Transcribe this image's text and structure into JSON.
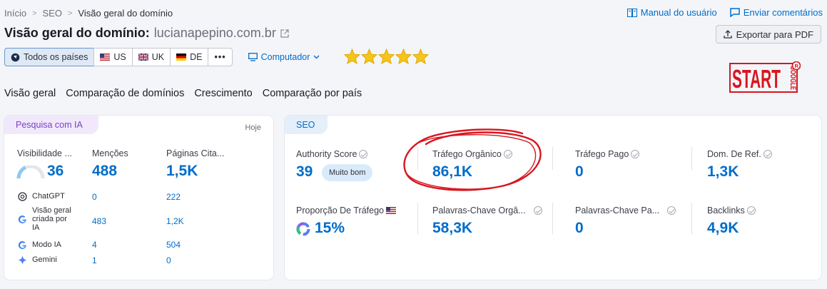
{
  "breadcrumb": {
    "home": "Início",
    "seo": "SEO",
    "current": "Visão geral do domínio"
  },
  "toplinks": {
    "manual": "Manual do usuário",
    "feedback": "Enviar comentários"
  },
  "title": {
    "label": "Visão geral do domínio:",
    "domain": "lucianapepino.com.br"
  },
  "export_label": "Exportar para PDF",
  "filters": {
    "all": "Todos os países",
    "us": "US",
    "uk": "UK",
    "de": "DE",
    "more": "•••",
    "device": "Computador"
  },
  "rating": {
    "stars": 5
  },
  "logo": {
    "text": "START",
    "sub": "GOOGLE",
    "badge": "R"
  },
  "tabs": [
    "Visão geral",
    "Comparação de domínios",
    "Crescimento",
    "Comparação por país"
  ],
  "ia_card": {
    "pill": "Pesquisa com IA",
    "date": "Hoje",
    "cols": [
      {
        "label": "Visibilidade ...",
        "value": "36"
      },
      {
        "label": "Menções",
        "value": "488"
      },
      {
        "label": "Páginas Cita...",
        "value": "1,5K"
      }
    ],
    "visibility_level": 0.36,
    "sources": [
      {
        "name": "ChatGPT",
        "mentions": "0",
        "pages": "222",
        "icon": "chatgpt-icon"
      },
      {
        "name": "Visão geral criada por IA",
        "mentions": "483",
        "pages": "1,2K",
        "icon": "google-icon"
      },
      {
        "name": "Modo IA",
        "mentions": "4",
        "pages": "504",
        "icon": "google-icon"
      },
      {
        "name": "Gemini",
        "mentions": "1",
        "pages": "0",
        "icon": "gemini-icon"
      }
    ]
  },
  "seo_card": {
    "pill": "SEO",
    "row1": [
      {
        "label": "Authority Score",
        "value": "39",
        "badge": "Muito bom"
      },
      {
        "label": "Tráfego Orgânico",
        "value": "86,1K"
      },
      {
        "label": "Tráfego Pago",
        "value": "0"
      },
      {
        "label": "Dom. De Ref.",
        "value": "1,3K"
      }
    ],
    "row2": [
      {
        "label": "Proporção De Tráfego",
        "value": "15%"
      },
      {
        "label": "Palavras-Chave Orgâ...",
        "value": "58,3K"
      },
      {
        "label": "Palavras-Chave Pa...",
        "value": "0"
      },
      {
        "label": "Backlinks",
        "value": "4,9K"
      }
    ]
  },
  "colors": {
    "accent": "#006dca",
    "highlight": "#d7161f",
    "star": "#f5c518"
  }
}
